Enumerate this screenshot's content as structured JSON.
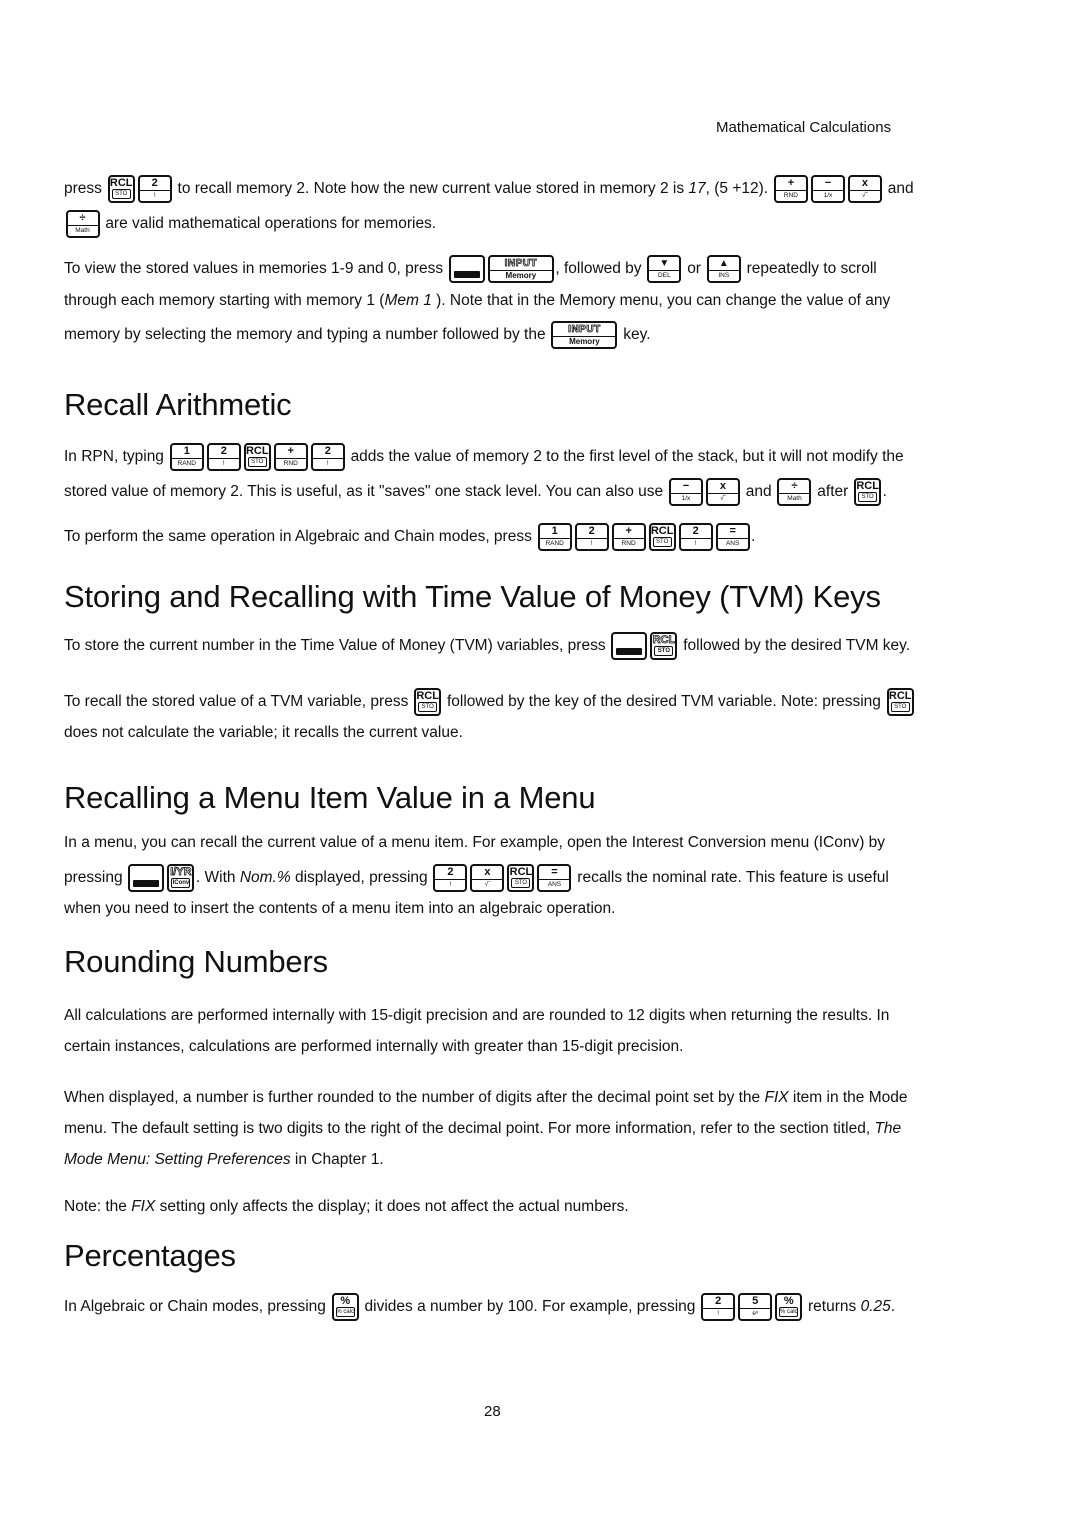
{
  "header": {
    "title": "Mathematical Calculations"
  },
  "page_number": "28",
  "keys": {
    "rcl_sto": {
      "top": "RCL",
      "bottom": "STO"
    },
    "two": {
      "top": "2",
      "bottom": "!"
    },
    "one": {
      "top": "1",
      "bottom": "RAND"
    },
    "five": {
      "top": "5",
      "bottom": "eˣ"
    },
    "plus": {
      "top": "+",
      "bottom": "RND"
    },
    "minus": {
      "top": "−",
      "bottom": "1/x"
    },
    "times": {
      "top": "x",
      "bottom": "√‾"
    },
    "divide": {
      "top": "÷",
      "bottom": "Math"
    },
    "equals": {
      "top": "=",
      "bottom": "ANS"
    },
    "input": {
      "top": "INPUT",
      "bottom": "Memory"
    },
    "down": {
      "top": "▼",
      "bottom": "DEL"
    },
    "up": {
      "top": "▲",
      "bottom": "INS"
    },
    "iyr": {
      "top": "I/YR",
      "bottom": "IConv"
    },
    "percent": {
      "top": "%",
      "bottom": "% calc"
    },
    "shift": {
      "top": "",
      "bottom": ""
    }
  },
  "intro": {
    "l1_a": "press",
    "l1_b": "to recall memory 2. Note how the new current value stored in memory 2 is ",
    "l1_c": "17",
    "l1_d": ", (5 +12).",
    "l1_e": "and",
    "l2": "are valid mathematical operations for memories.",
    "l3_a": "To view the stored values in memories 1-9 and 0, press",
    "l3_b": ", followed by",
    "l3_c": "or",
    "l3_d": "repeatedly to scroll",
    "l4_a": "through each memory starting with memory 1 (",
    "l4_b": "Mem 1",
    "l4_c": " ). Note that in the Memory menu, you can change the value of any",
    "l5_a": "memory by selecting the memory and typing a number followed by the",
    "l5_b": "key."
  },
  "recall_arithmetic": {
    "heading": "Recall Arithmetic",
    "l1_a": "In RPN, typing",
    "l1_b": "adds the value of memory 2 to the first level of the stack, but it will not modify the",
    "l2_a": "stored value of memory 2. This is useful, as it \"saves\" one stack level. You can also use",
    "l2_b": "and",
    "l2_c": "after",
    "l2_d": ".",
    "l3_a": "To perform the same operation in Algebraic and Chain modes, press",
    "l3_b": "."
  },
  "tvm": {
    "heading": "Storing and Recalling with Time Value of Money (TVM) Keys",
    "l1_a": "To store the current number in the Time Value of Money (TVM) variables, press",
    "l1_b": "followed by the desired TVM key.",
    "l2_a": "To recall the stored value of a TVM variable, press",
    "l2_b": "followed by the key of the desired TVM variable. Note: pressing",
    "l3": "does not calculate the variable; it recalls the current value."
  },
  "menu_recall": {
    "heading": "Recalling a Menu Item Value in a Menu",
    "l1": "In a menu, you can recall the current value of a menu item. For example, open the Interest Conversion menu (IConv) by",
    "l2_a": "pressing",
    "l2_b": ". With ",
    "l2_c": "Nom.%",
    "l2_d": " displayed, pressing",
    "l2_e": "recalls the nominal rate. This feature is useful",
    "l3": "when you need to insert the contents of a menu item into an algebraic operation."
  },
  "rounding": {
    "heading": "Rounding Numbers",
    "p1_l1": "All calculations are performed internally with 15-digit precision and are rounded to 12 digits when returning the results. In",
    "p1_l2": "certain instances, calculations are performed internally with greater than 15-digit precision.",
    "p2_l1_a": "When displayed, a number is further rounded to the number of digits after the decimal point set by the ",
    "p2_l1_b": "FIX",
    "p2_l1_c": " item in the Mode",
    "p2_l2_a": "menu. The default setting is two digits to the right of the decimal point. For more information, refer to the section titled, ",
    "p2_l2_b": "The",
    "p2_l3_a": "Mode Menu: Setting Preferences",
    "p2_l3_b": " in Chapter 1.",
    "p3_a": "Note: the ",
    "p3_b": "FIX",
    "p3_c": " setting only affects the display; it does not affect the actual numbers."
  },
  "percentages": {
    "heading": "Percentages",
    "l1_a": "In Algebraic or Chain modes, pressing",
    "l1_b": "divides a number by 100. For example, pressing",
    "l1_c": "returns ",
    "l1_d": "0.25",
    "l1_e": "."
  }
}
